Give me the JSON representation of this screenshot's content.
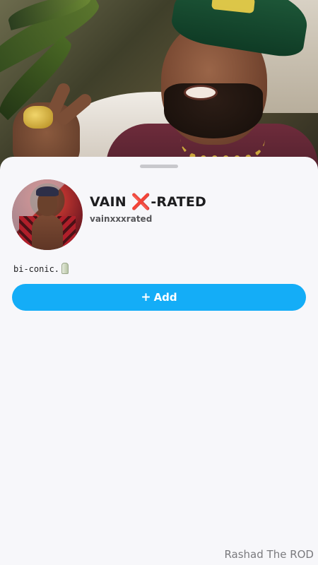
{
  "profile": {
    "display_name_prefix": "VAIN ",
    "display_name_mark": "❌",
    "display_name_suffix": "-RATED",
    "username": "vainxxxrated",
    "bio": "bi-conic."
  },
  "actions": {
    "add_icon": "+",
    "add_label": "Add"
  },
  "watermark": "Rashad The ROD",
  "colors": {
    "accent_button": "#14adf7",
    "sheet_background": "#f7f7fa"
  },
  "icons": {
    "bio_emoji": "crystal-icon",
    "name_mark": "cross-mark-icon"
  }
}
